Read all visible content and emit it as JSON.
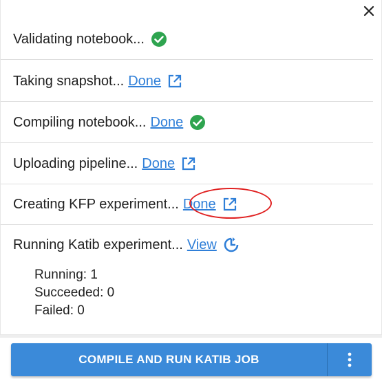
{
  "steps": [
    {
      "label": "Validating notebook...",
      "link": "",
      "icon": "check-circle-icon"
    },
    {
      "label": "Taking snapshot...",
      "link": "Done",
      "icon": "open-in-new-icon"
    },
    {
      "label": "Compiling notebook...",
      "link": "Done",
      "icon": "check-circle-icon"
    },
    {
      "label": "Uploading pipeline...",
      "link": "Done",
      "icon": "open-in-new-icon"
    },
    {
      "label": "Creating KFP experiment...",
      "link": "Done",
      "icon": "open-in-new-icon"
    }
  ],
  "katib": {
    "label": "Running Katib experiment...",
    "link": "View",
    "icon": "refresh-icon",
    "running": "Running: 1",
    "succeeded": "Succeeded: 0",
    "failed": "Failed: 0"
  },
  "action": {
    "main_label": "COMPILE AND RUN KATIB JOB",
    "more_icon": "more-vert-icon"
  },
  "colors": {
    "link": "#2f7fd8",
    "success": "#2ea44f",
    "button": "#3b8ad9",
    "annotation": "#e02020"
  }
}
